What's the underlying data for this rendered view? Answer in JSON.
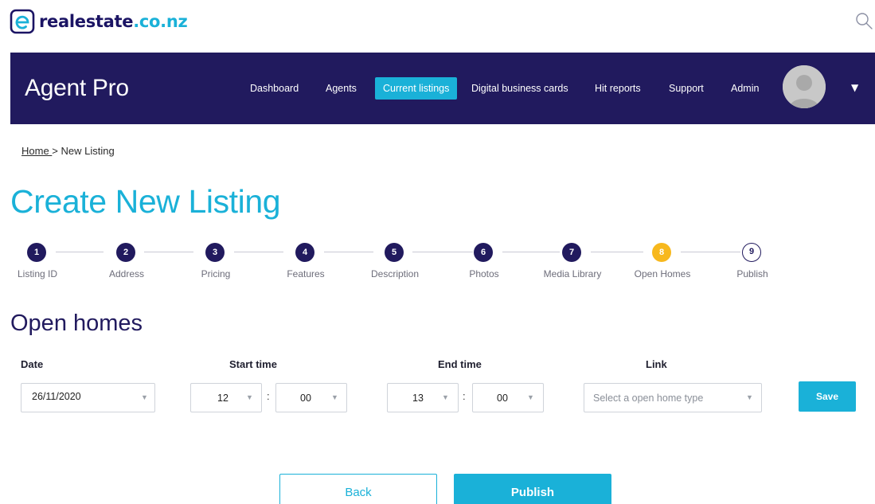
{
  "header": {
    "logo_text": "realestate",
    "logo_tld": ".co.nz",
    "search_icon": "search-icon"
  },
  "navbar": {
    "brand": "Agent Pro",
    "items": [
      {
        "label": "Dashboard",
        "active": false
      },
      {
        "label": "Agents",
        "active": false
      },
      {
        "label": "Current listings",
        "active": true
      },
      {
        "label": "Digital business cards",
        "active": false
      },
      {
        "label": "Hit reports",
        "active": false
      },
      {
        "label": "Support",
        "active": false
      },
      {
        "label": "Admin",
        "active": false
      }
    ],
    "caret": "▼"
  },
  "breadcrumb": {
    "home": "Home ",
    "separator": ">",
    "current": "New Listing"
  },
  "page_title": "Create New Listing",
  "stepper": {
    "current_step": 8,
    "steps": [
      {
        "number": "1",
        "label": "Listing ID"
      },
      {
        "number": "2",
        "label": "Address"
      },
      {
        "number": "3",
        "label": "Pricing"
      },
      {
        "number": "4",
        "label": "Features"
      },
      {
        "number": "5",
        "label": "Description"
      },
      {
        "number": "6",
        "label": "Photos"
      },
      {
        "number": "7",
        "label": "Media Library"
      },
      {
        "number": "8",
        "label": "Open Homes"
      },
      {
        "number": "9",
        "label": "Publish"
      }
    ]
  },
  "open_homes": {
    "title": "Open homes",
    "labels": {
      "date": "Date",
      "start_time": "Start time",
      "end_time": "End time",
      "link": "Link"
    },
    "date_value": "26/11/2020",
    "start_hour": "12",
    "start_minute": "00",
    "end_hour": "13",
    "end_minute": "00",
    "time_separator": ":",
    "link_placeholder": "Select a open home type",
    "save_label": "Save"
  },
  "footer_buttons": {
    "back": "Back",
    "publish": "Publish"
  },
  "colors": {
    "brand_navy": "#211a5e",
    "accent_cyan": "#1ab1d8",
    "current_step": "#f7b81d"
  }
}
